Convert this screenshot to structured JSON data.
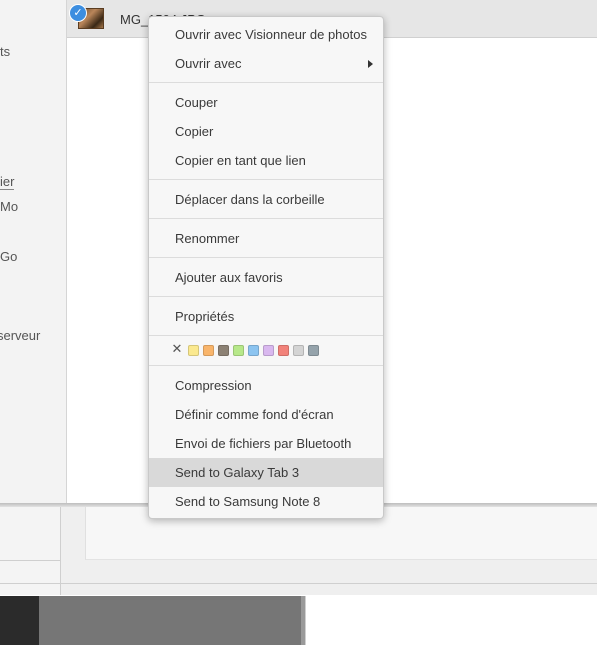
{
  "sidebar": {
    "fragments": [
      {
        "text": "ts"
      },
      {
        "text": "ier"
      },
      {
        "text": "Mo"
      },
      {
        "text": "Go"
      },
      {
        "text": "serveur"
      }
    ]
  },
  "file_view": {
    "selected_file_name": "MG_1504.JPG"
  },
  "context_menu": {
    "items": [
      {
        "label": "Ouvrir avec Visionneur de photos"
      },
      {
        "label": "Ouvrir avec",
        "has_submenu": true
      },
      {
        "label": "Couper"
      },
      {
        "label": "Copier"
      },
      {
        "label": "Copier en tant que lien"
      },
      {
        "label": "Déplacer dans la corbeille"
      },
      {
        "label": "Renommer"
      },
      {
        "label": "Ajouter aux favoris"
      },
      {
        "label": "Propriétés"
      },
      {
        "label": "Compression"
      },
      {
        "label": "Définir comme fond d'écran"
      },
      {
        "label": "Envoi de fichiers par Bluetooth"
      },
      {
        "label": "Send to Galaxy Tab 3",
        "highlighted": true
      },
      {
        "label": "Send to Samsung Note 8"
      }
    ],
    "color_tags": {
      "clear_icon": "close-icon",
      "colors": [
        "#fbe98f",
        "#f9b56b",
        "#8c8174",
        "#b7e88a",
        "#8cc4f0",
        "#d9b8ef",
        "#f2827a",
        "#d4d4d4",
        "#95a3ab"
      ]
    }
  }
}
